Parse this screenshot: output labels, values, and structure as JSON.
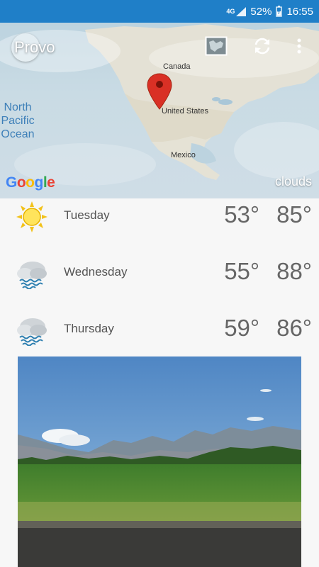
{
  "status_bar": {
    "network": "4G",
    "battery": "52%",
    "time": "16:55"
  },
  "header": {
    "city": "Provo",
    "icons": [
      "map-view-icon",
      "refresh-icon",
      "more-vert-icon"
    ]
  },
  "map": {
    "labels": {
      "canada": "Canada",
      "united_states": "United States",
      "mexico": "Mexico",
      "ocean_line1": "North",
      "ocean_line2": "Pacific",
      "ocean_line3": "Ocean"
    },
    "google": [
      "G",
      "o",
      "o",
      "g",
      "l",
      "e"
    ],
    "google_colors": [
      "#4285F4",
      "#EA4335",
      "#FBBC05",
      "#4285F4",
      "#34A853",
      "#EA4335"
    ],
    "layer": "clouds",
    "pin_color": "#d93025"
  },
  "forecast": [
    {
      "day": "Tuesday",
      "icon": "sun-icon",
      "low": "53°",
      "high": "85°"
    },
    {
      "day": "Wednesday",
      "icon": "rain-cloud-icon",
      "low": "55°",
      "high": "88°"
    },
    {
      "day": "Thursday",
      "icon": "rain-cloud-icon",
      "low": "59°",
      "high": "86°"
    }
  ]
}
